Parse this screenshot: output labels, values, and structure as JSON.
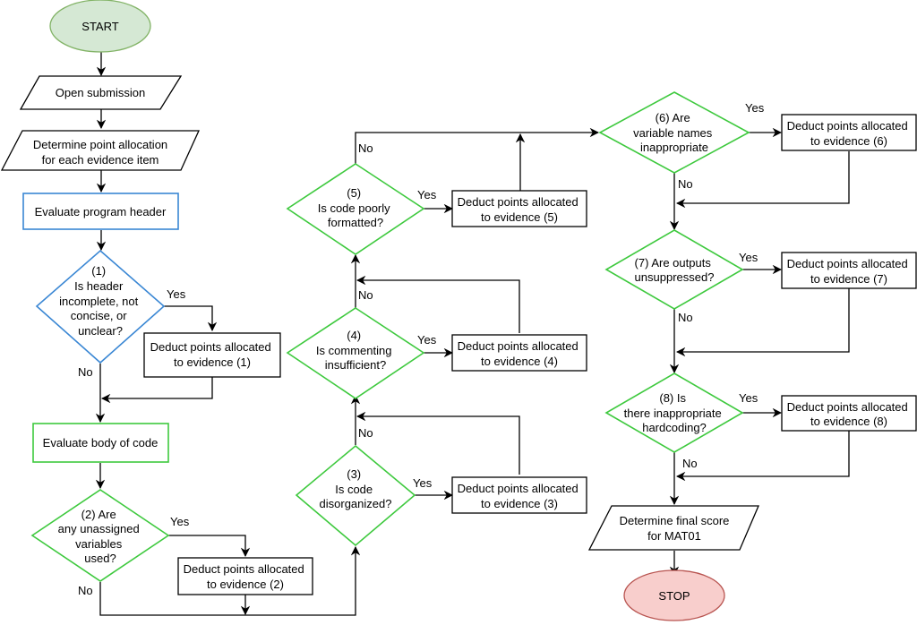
{
  "diagram": {
    "start": "START",
    "stop": "STOP",
    "open_submission": "Open submission",
    "determine_allocation": [
      "Determine point allocation",
      "for each evidence item"
    ],
    "evaluate_header": "Evaluate program header",
    "evaluate_body": "Evaluate body of code",
    "final_score": [
      "Determine final score",
      "for MAT01"
    ],
    "decisions": [
      {
        "id": 1,
        "lines": [
          "(1)",
          "Is header",
          "incomplete, not",
          "concise, or",
          "unclear?"
        ]
      },
      {
        "id": 2,
        "lines": [
          "(2) Are",
          "any unassigned",
          "variables",
          "used?"
        ]
      },
      {
        "id": 3,
        "lines": [
          "(3)",
          "Is code",
          "disorganized?"
        ]
      },
      {
        "id": 4,
        "lines": [
          "(4)",
          "Is commenting",
          "insufficient?"
        ]
      },
      {
        "id": 5,
        "lines": [
          "(5)",
          "Is code poorly",
          "formatted?"
        ]
      },
      {
        "id": 6,
        "lines": [
          "(6) Are",
          "variable names",
          "inappropriate"
        ]
      },
      {
        "id": 7,
        "lines": [
          "(7) Are outputs",
          "unsuppressed?"
        ]
      },
      {
        "id": 8,
        "lines": [
          "(8) Is",
          "there inappropriate",
          "hardcoding?"
        ]
      }
    ],
    "deductions": [
      [
        "Deduct points allocated",
        "to evidence (1)"
      ],
      [
        "Deduct points allocated",
        "to evidence (2)"
      ],
      [
        "Deduct points allocated",
        "to evidence (3)"
      ],
      [
        "Deduct points allocated",
        "to evidence (4)"
      ],
      [
        "Deduct points allocated",
        "to evidence (5)"
      ],
      [
        "Deduct points allocated",
        "to evidence (6)"
      ],
      [
        "Deduct points allocated",
        "to evidence (7)"
      ],
      [
        "Deduct points allocated",
        "to evidence (8)"
      ]
    ],
    "yes_label": "Yes",
    "no_label": "No",
    "colors": {
      "start_fill": "#d5e8d4",
      "start_stroke": "#82b366",
      "stop_fill": "#f8cecc",
      "stop_stroke": "#b85450",
      "header_stroke": "#3a87d4",
      "body_stroke": "#3ec93e"
    }
  }
}
